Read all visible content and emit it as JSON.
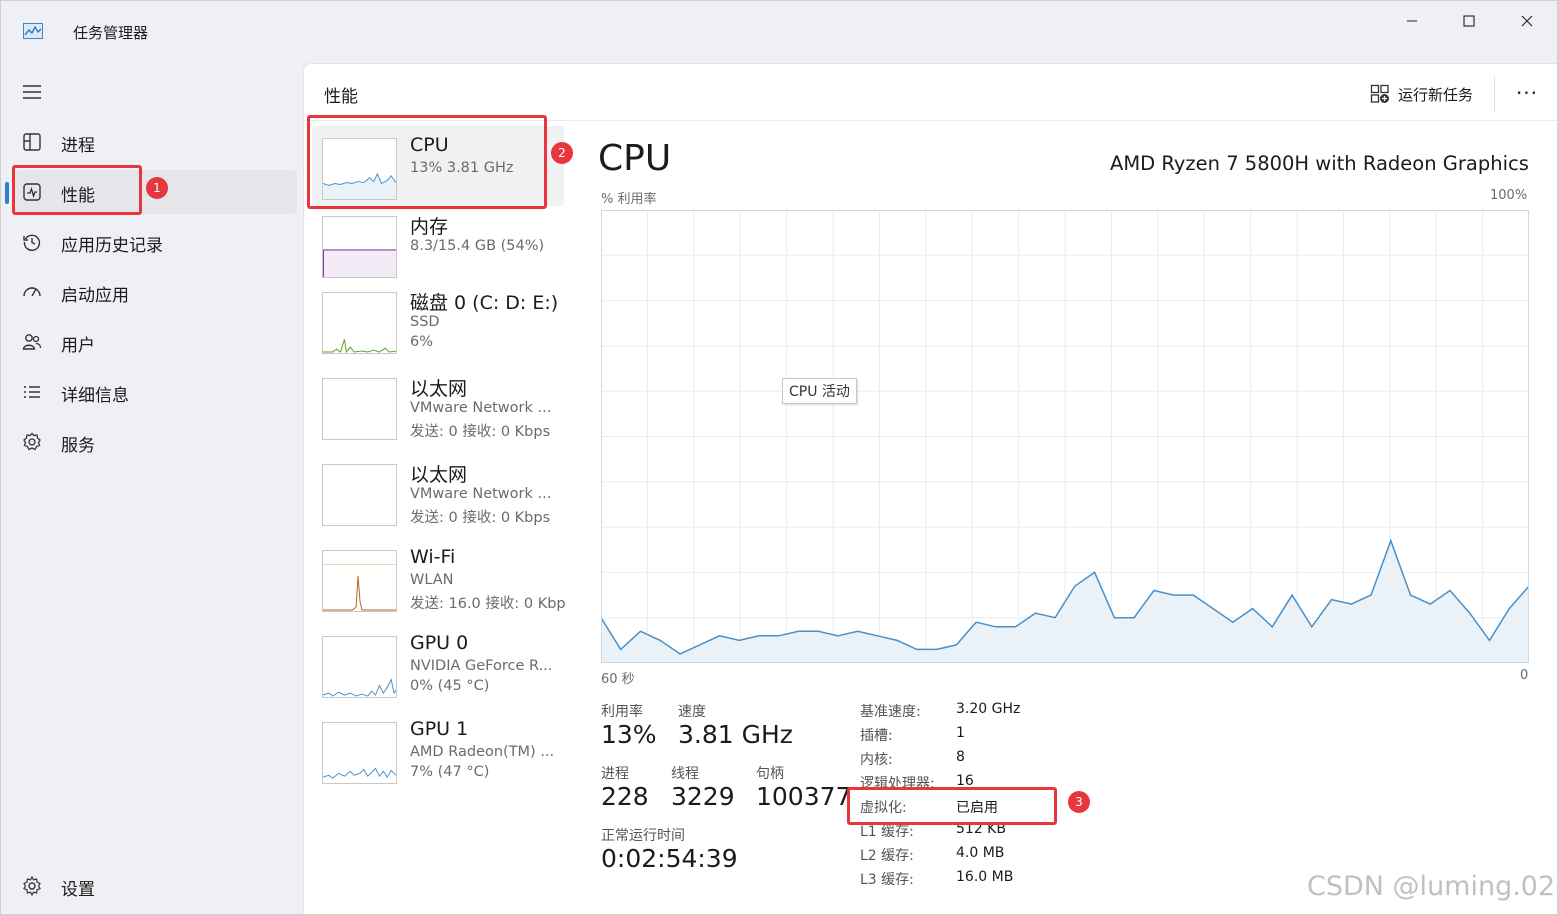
{
  "window": {
    "title": "任务管理器",
    "controls": {
      "minimize": "─",
      "maximize": "☐",
      "close": "✕"
    }
  },
  "sidebar": {
    "items": [
      {
        "label": "进程",
        "icon": "processes-icon"
      },
      {
        "label": "性能",
        "icon": "performance-icon",
        "active": true
      },
      {
        "label": "应用历史记录",
        "icon": "history-icon"
      },
      {
        "label": "启动应用",
        "icon": "startup-icon"
      },
      {
        "label": "用户",
        "icon": "users-icon"
      },
      {
        "label": "详细信息",
        "icon": "details-icon"
      },
      {
        "label": "服务",
        "icon": "services-icon"
      }
    ],
    "settings_label": "设置"
  },
  "header": {
    "title": "性能",
    "run_task_label": "运行新任务",
    "more_label": "···"
  },
  "devices": [
    {
      "name": "CPU",
      "sub1": "13%  3.81 GHz",
      "sub2": ""
    },
    {
      "name": "内存",
      "sub1": "8.3/15.4 GB (54%)",
      "sub2": ""
    },
    {
      "name": "磁盘 0 (C: D: E:)",
      "sub1": "SSD",
      "sub2": "6%"
    },
    {
      "name": "以太网",
      "sub1": "VMware Network ...",
      "sub2": "发送: 0 接收: 0 Kbps"
    },
    {
      "name": "以太网",
      "sub1": "VMware Network ...",
      "sub2": "发送: 0 接收: 0 Kbps"
    },
    {
      "name": "Wi-Fi",
      "sub1": "WLAN",
      "sub2": "发送: 16.0 接收: 0 Kbp"
    },
    {
      "name": "GPU 0",
      "sub1": "NVIDIA GeForce R...",
      "sub2": "0% (45 °C)"
    },
    {
      "name": "GPU 1",
      "sub1": "AMD Radeon(TM) ...",
      "sub2": "7% (47 °C)"
    }
  ],
  "detail": {
    "title": "CPU",
    "processor": "AMD Ryzen 7 5800H with Radeon Graphics",
    "chart_ylabel": "% 利用率",
    "chart_ymax": "100%",
    "chart_xleft": "60 秒",
    "chart_xright": "0",
    "tooltip": "CPU 活动",
    "stats": {
      "util_label": "利用率",
      "util_value": "13%",
      "speed_label": "速度",
      "speed_value": "3.81 GHz",
      "proc_label": "进程",
      "proc_value": "228",
      "thread_label": "线程",
      "thread_value": "3229",
      "handle_label": "句柄",
      "handle_value": "100377",
      "uptime_label": "正常运行时间",
      "uptime_value": "0:02:54:39"
    },
    "specs": [
      {
        "key": "基准速度:",
        "value": "3.20 GHz"
      },
      {
        "key": "插槽:",
        "value": "1"
      },
      {
        "key": "内核:",
        "value": "8"
      },
      {
        "key": "逻辑处理器:",
        "value": "16"
      },
      {
        "key": "虚拟化:",
        "value": "已启用"
      },
      {
        "key": "L1 缓存:",
        "value": "512 KB"
      },
      {
        "key": "L2 缓存:",
        "value": "4.0 MB"
      },
      {
        "key": "L3 缓存:",
        "value": "16.0 MB"
      }
    ]
  },
  "annotations": [
    "1",
    "2",
    "3"
  ],
  "watermark": "CSDN @luming.02",
  "colors": {
    "cpu_line": "#4a90c8",
    "cpu_fill": "#eaf2f8",
    "memory_line": "#8b3ea8",
    "disk_line": "#5aa02c",
    "wifi_line": "#b5651d",
    "annotation": "#e8363f",
    "accent": "#2f7fd1"
  },
  "chart_data": {
    "type": "area",
    "title": "",
    "xlabel": "",
    "ylabel": "% 利用率",
    "ylim": [
      0,
      100
    ],
    "x_range_seconds": [
      60,
      0
    ],
    "grid": true,
    "values": [
      10,
      3,
      7,
      5,
      2,
      4,
      6,
      5,
      6,
      6,
      7,
      7,
      6,
      7,
      6,
      5,
      3,
      3,
      4,
      9,
      8,
      8,
      11,
      10,
      17,
      20,
      10,
      10,
      16,
      15,
      15,
      12,
      9,
      12,
      8,
      15,
      8,
      14,
      13,
      15,
      27,
      15,
      13,
      16,
      11,
      5,
      12,
      17
    ]
  }
}
